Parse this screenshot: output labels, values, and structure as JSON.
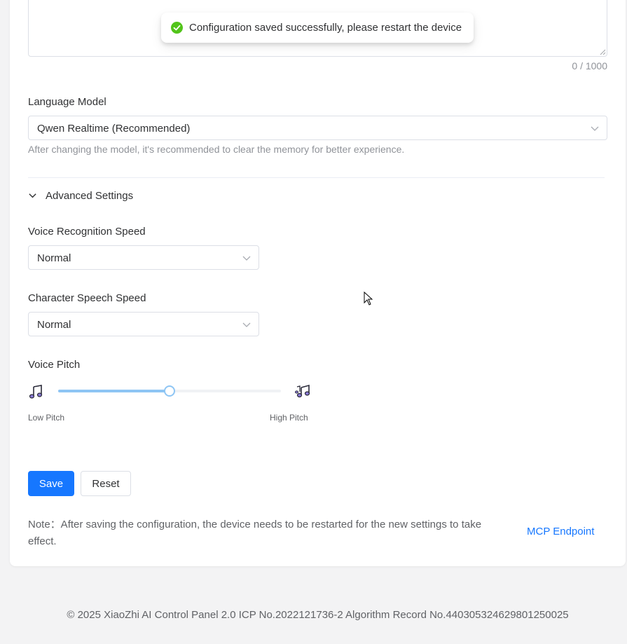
{
  "toast": {
    "message": "Configuration saved successfully, please restart the device",
    "status_icon": "check-circle-icon",
    "status_color": "#52c41a"
  },
  "prompt": {
    "counter": "0 / 1000"
  },
  "language_model": {
    "label": "Language Model",
    "selected": "Qwen Realtime (Recommended)",
    "hint": "After changing the model, it's recommended to clear the memory for better experience."
  },
  "advanced": {
    "label": "Advanced Settings",
    "expanded": true
  },
  "voice_recognition_speed": {
    "label": "Voice Recognition Speed",
    "selected": "Normal"
  },
  "character_speech_speed": {
    "label": "Character Speech Speed",
    "selected": "Normal"
  },
  "voice_pitch": {
    "label": "Voice Pitch",
    "low_label": "Low Pitch",
    "high_label": "High Pitch",
    "value_fraction": 0.5,
    "low_icon": "music-note-icon",
    "high_icon": "music-notes-icon"
  },
  "actions": {
    "save_label": "Save",
    "reset_label": "Reset"
  },
  "note": "Note：After saving the configuration, the device needs to be restarted for the new settings to take effect.",
  "mcp_link": "MCP Endpoint",
  "footer": "© 2025 XiaoZhi AI Control Panel 2.0 ICP No.2022121736-2 Algorithm Record No.440305324629801250025",
  "colors": {
    "primary": "#1677ff",
    "slider": "#8ec5f4",
    "success": "#52c41a"
  }
}
